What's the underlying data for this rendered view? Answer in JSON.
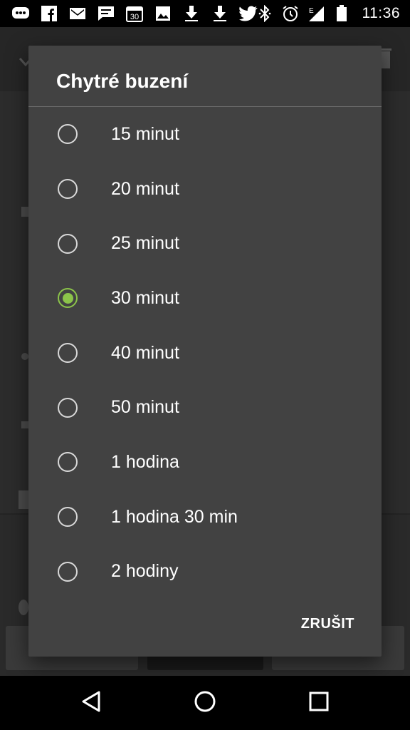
{
  "status_bar": {
    "time": "11:36",
    "left_icons": [
      "message-icon",
      "facebook-icon",
      "gmail-icon",
      "chat-icon",
      "calendar-icon",
      "image-icon",
      "download-icon",
      "download-icon",
      "twitter-icon"
    ],
    "calendar_number": "30",
    "right_icons": [
      "bluetooth-icon",
      "alarm-icon",
      "signal-icon",
      "battery-icon"
    ],
    "network_letter": "E"
  },
  "dialog": {
    "title": "Chytré buzení",
    "options": [
      {
        "label": "15 minut",
        "checked": false
      },
      {
        "label": "20 minut",
        "checked": false
      },
      {
        "label": "25 minut",
        "checked": false
      },
      {
        "label": "30 minut",
        "checked": true
      },
      {
        "label": "40 minut",
        "checked": false
      },
      {
        "label": "50 minut",
        "checked": false
      },
      {
        "label": "1 hodina",
        "checked": false
      },
      {
        "label": "1 hodina 30 min",
        "checked": false
      },
      {
        "label": "2 hodiny",
        "checked": false
      }
    ],
    "cancel_label": "ZRUŠIT",
    "accent_color": "#8bc34a"
  },
  "nav_bar": {
    "icons": [
      "back-icon",
      "home-icon",
      "recents-icon"
    ]
  }
}
